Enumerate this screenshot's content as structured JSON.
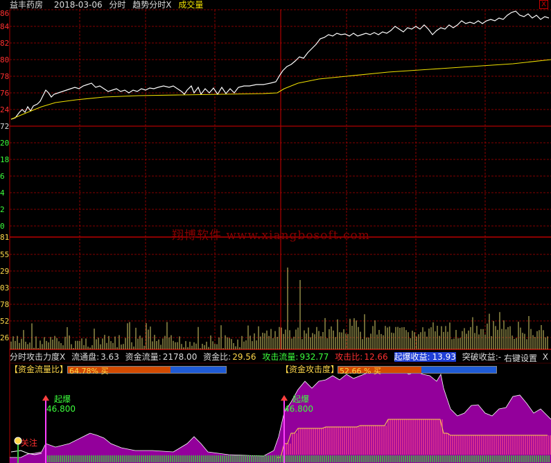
{
  "header": {
    "stock_name": "益丰药房",
    "date": "2018-03-06",
    "mode": "分时",
    "indicator": "趋势分时X",
    "volume_label": "成交量",
    "close_mark": "X"
  },
  "price_axis_labels": [
    "86",
    "84",
    "82",
    "80",
    "78",
    "76",
    "24",
    "72",
    "20",
    "18",
    "6",
    "4",
    "2",
    "0"
  ],
  "volume_axis_labels": [
    "81",
    "55",
    "29",
    "03",
    "78",
    "52",
    "26"
  ],
  "watermark": "翔博软件 www.xiangbosoft.com",
  "info_bar": {
    "title": "分时攻击力度X",
    "float_label": "流通盘:",
    "float_value": "3.63",
    "fund_flow_label": "资金流量:",
    "fund_flow_value": "2178.00",
    "fund_ratio_label": "资金比:",
    "fund_ratio_value": "29.56",
    "attack_flow_label": "攻击流量:",
    "attack_flow_value": "932.77",
    "attack_ratio_label": "攻击比:",
    "attack_ratio_value": "12.66",
    "surge_label": "起爆收益:",
    "surge_value": "13.93",
    "breakout_label": "突破收益:",
    "breakout_value": "-",
    "settings": "右键设置",
    "close": "X"
  },
  "gauge_left": {
    "title": "【资金流量比】",
    "percent_text": "64.78% 买",
    "percent": 64.78
  },
  "gauge_right": {
    "title": "【资金攻击度】",
    "percent_text": "52.66 % 买",
    "percent": 52.66
  },
  "signals": [
    {
      "label": "起爆",
      "value": "46.800"
    },
    {
      "label": "起爆",
      "value": "46.800"
    }
  ],
  "follow_label": "关注",
  "colors": {
    "grid": "#b00000",
    "price": "#ffffff",
    "avg": "#f0e000",
    "volume": "#d8d06a",
    "purple": "#a000a8",
    "magenta": "#ff40ff",
    "green": "#3cc83c",
    "red_up": "#ff4040",
    "cyan": "#00e0e0"
  }
}
